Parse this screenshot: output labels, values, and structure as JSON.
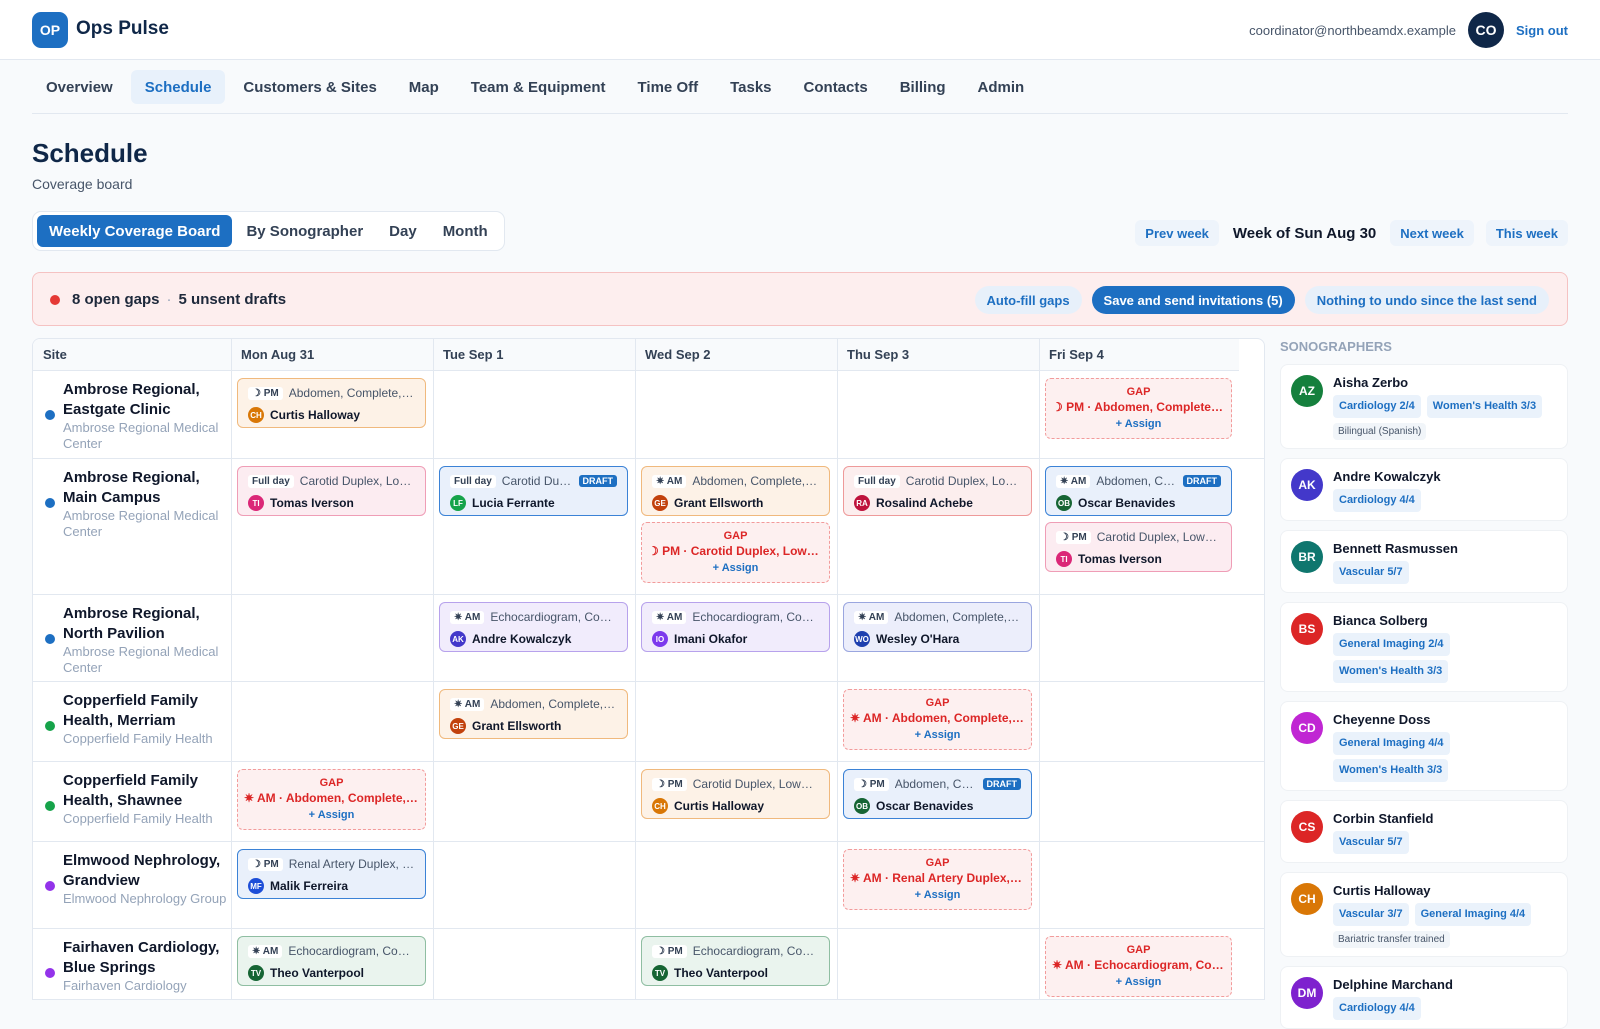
{
  "app": {
    "logo": "OP",
    "name": "Ops Pulse"
  },
  "user": {
    "email": "coordinator@northbeamdx.example",
    "initials": "CO",
    "signout": "Sign out"
  },
  "nav": [
    {
      "label": "Overview"
    },
    {
      "label": "Schedule",
      "active": true
    },
    {
      "label": "Customers & Sites"
    },
    {
      "label": "Map"
    },
    {
      "label": "Team & Equipment"
    },
    {
      "label": "Time Off"
    },
    {
      "label": "Tasks"
    },
    {
      "label": "Contacts"
    },
    {
      "label": "Billing"
    },
    {
      "label": "Admin"
    }
  ],
  "page": {
    "title": "Schedule",
    "subtitle": "Coverage board"
  },
  "views": [
    {
      "label": "Weekly Coverage Board",
      "active": true
    },
    {
      "label": "By Sonographer"
    },
    {
      "label": "Day"
    },
    {
      "label": "Month"
    }
  ],
  "week": {
    "prev": "Prev week",
    "label": "Week of Sun Aug 30",
    "next": "Next week",
    "today": "This week"
  },
  "banner": {
    "gaps": "8 open gaps",
    "sep": "·",
    "drafts": "5 unsent drafts",
    "autofill": "Auto-fill gaps",
    "send": "Save and send invitations (5)",
    "undo": "Nothing to undo since the last send"
  },
  "grid": {
    "site_header": "Site",
    "days": [
      "Mon Aug 31",
      "Tue Sep 1",
      "Wed Sep 2",
      "Thu Sep 3",
      "Fri Sep 4"
    ],
    "gap_label": "GAP",
    "assign_label": "+ Assign",
    "draft_label": "DRAFT",
    "rows": [
      {
        "name": "Ambrose Regional, Eastgate Clinic",
        "org": "Ambrose Regional Medical Center",
        "color": "#1d6fc2",
        "cells": [
          [
            {
              "shift": "☽ PM",
              "service": "Abdomen, Complete, Re...",
              "initials": "CH",
              "person": "Curtis Halloway",
              "tone": "or",
              "av": "#d97706"
            }
          ],
          [],
          [],
          [],
          [
            {
              "gap": true,
              "text": "☽ PM · Abdomen, Complete, Re..."
            }
          ]
        ]
      },
      {
        "name": "Ambrose Regional, Main Campus",
        "org": "Ambrose Regional Medical Center",
        "color": "#1d6fc2",
        "cells": [
          [
            {
              "shift": "Full day",
              "service": "Carotid Duplex, Lowe...",
              "initials": "TI",
              "person": "Tomas Iverson",
              "tone": "pk",
              "av": "#db2777"
            }
          ],
          [
            {
              "shift": "Full day",
              "service": "Carotid Duple...",
              "draft": true,
              "initials": "LF",
              "person": "Lucia Ferrante",
              "tone": "bl",
              "av": "#16a34a"
            }
          ],
          [
            {
              "shift": "✷ AM",
              "service": "Abdomen, Complete, R...",
              "initials": "GE",
              "person": "Grant Ellsworth",
              "tone": "or",
              "av": "#c2410c"
            },
            {
              "gap": true,
              "text": "☽ PM · Carotid Duplex, Lower E..."
            }
          ],
          [
            {
              "shift": "Full day",
              "service": "Carotid Duplex, Lowe...",
              "initials": "RA",
              "person": "Rosalind Achebe",
              "tone": "rd",
              "av": "#be123c"
            }
          ],
          [
            {
              "shift": "✷ AM",
              "service": "Abdomen, Com...",
              "draft": true,
              "initials": "OB",
              "person": "Oscar Benavides",
              "tone": "bl",
              "av": "#166534"
            },
            {
              "shift": "☽ PM",
              "service": "Carotid Duplex, Lower E...",
              "initials": "TI",
              "person": "Tomas Iverson",
              "tone": "pk",
              "av": "#db2777"
            }
          ]
        ]
      },
      {
        "name": "Ambrose Regional, North Pavilion",
        "org": "Ambrose Regional Medical Center",
        "color": "#1d6fc2",
        "cells": [
          [],
          [
            {
              "shift": "✷ AM",
              "service": "Echocardiogram, Comp...",
              "initials": "AK",
              "person": "Andre Kowalczyk",
              "tone": "pu",
              "av": "#4338ca"
            }
          ],
          [
            {
              "shift": "✷ AM",
              "service": "Echocardiogram, Comp...",
              "initials": "IO",
              "person": "Imani Okafor",
              "tone": "pu",
              "av": "#7c3aed"
            }
          ],
          [
            {
              "shift": "✷ AM",
              "service": "Abdomen, Complete, R...",
              "initials": "WO",
              "person": "Wesley O'Hara",
              "tone": "in",
              "av": "#1e40af"
            }
          ],
          []
        ]
      },
      {
        "name": "Copperfield Family Health, Merriam",
        "org": "Copperfield Family Health",
        "color": "#16a34a",
        "cells": [
          [],
          [
            {
              "shift": "✷ AM",
              "service": "Abdomen, Complete, T...",
              "initials": "GE",
              "person": "Grant Ellsworth",
              "tone": "or",
              "av": "#c2410c"
            }
          ],
          [],
          [
            {
              "gap": true,
              "text": "✷ AM · Abdomen, Complete, R..."
            }
          ],
          []
        ]
      },
      {
        "name": "Copperfield Family Health, Shawnee",
        "org": "Copperfield Family Health",
        "color": "#16a34a",
        "cells": [
          [
            {
              "gap": true,
              "text": "✷ AM · Abdomen, Complete, R..."
            }
          ],
          [],
          [
            {
              "shift": "☽ PM",
              "service": "Carotid Duplex, Lower E...",
              "initials": "CH",
              "person": "Curtis Halloway",
              "tone": "or",
              "av": "#d97706"
            }
          ],
          [
            {
              "shift": "☽ PM",
              "service": "Abdomen, Com...",
              "draft": true,
              "initials": "OB",
              "person": "Oscar Benavides",
              "tone": "bl",
              "av": "#166534"
            }
          ],
          []
        ]
      },
      {
        "name": "Elmwood Nephrology, Grandview",
        "org": "Elmwood Nephrology Group",
        "color": "#9333ea",
        "cells": [
          [
            {
              "shift": "☽ PM",
              "service": "Renal Artery Duplex, Dia...",
              "initials": "MF",
              "person": "Malik Ferreira",
              "tone": "bl",
              "av": "#1d4ed8"
            }
          ],
          [],
          [],
          [
            {
              "gap": true,
              "text": "✷ AM · Renal Artery Duplex, Di..."
            }
          ],
          []
        ]
      },
      {
        "name": "Fairhaven Cardiology, Blue Springs",
        "org": "Fairhaven Cardiology",
        "color": "#9333ea",
        "cells": [
          [
            {
              "shift": "✷ AM",
              "service": "Echocardiogram, Comp...",
              "initials": "TV",
              "person": "Theo Vanterpool",
              "tone": "gr",
              "av": "#166534"
            }
          ],
          [],
          [
            {
              "shift": "☽ PM",
              "service": "Echocardiogram, Compl...",
              "initials": "TV",
              "person": "Theo Vanterpool",
              "tone": "gr",
              "av": "#166534"
            }
          ],
          [],
          [
            {
              "gap": true,
              "text": "✷ AM · Echocardiogram, Comp..."
            }
          ]
        ]
      }
    ]
  },
  "sidebar": {
    "title": "SONOGRAPHERS",
    "people": [
      {
        "initials": "AZ",
        "name": "Aisha Zerbo",
        "color": "#15803d",
        "tags": [
          "Cardiology 2/4",
          "Women's Health 3/3"
        ],
        "note": "Bilingual (Spanish)"
      },
      {
        "initials": "AK",
        "name": "Andre Kowalczyk",
        "color": "#4338ca",
        "tags": [
          "Cardiology 4/4"
        ]
      },
      {
        "initials": "BR",
        "name": "Bennett Rasmussen",
        "color": "#0f766e",
        "tags": [
          "Vascular 5/7"
        ]
      },
      {
        "initials": "BS",
        "name": "Bianca Solberg",
        "color": "#dc2626",
        "tags": [
          "General Imaging 2/4",
          "Women's Health 3/3"
        ]
      },
      {
        "initials": "CD",
        "name": "Cheyenne Doss",
        "color": "#c026d3",
        "tags": [
          "General Imaging 4/4",
          "Women's Health 3/3"
        ]
      },
      {
        "initials": "CS",
        "name": "Corbin Stanfield",
        "color": "#dc2626",
        "tags": [
          "Vascular 5/7"
        ]
      },
      {
        "initials": "CH",
        "name": "Curtis Halloway",
        "color": "#d97706",
        "tags": [
          "Vascular 3/7",
          "General Imaging 4/4"
        ],
        "note": "Bariatric transfer trained"
      },
      {
        "initials": "DM",
        "name": "Delphine Marchand",
        "color": "#7e22ce",
        "tags": [
          "Cardiology 4/4"
        ]
      }
    ]
  }
}
